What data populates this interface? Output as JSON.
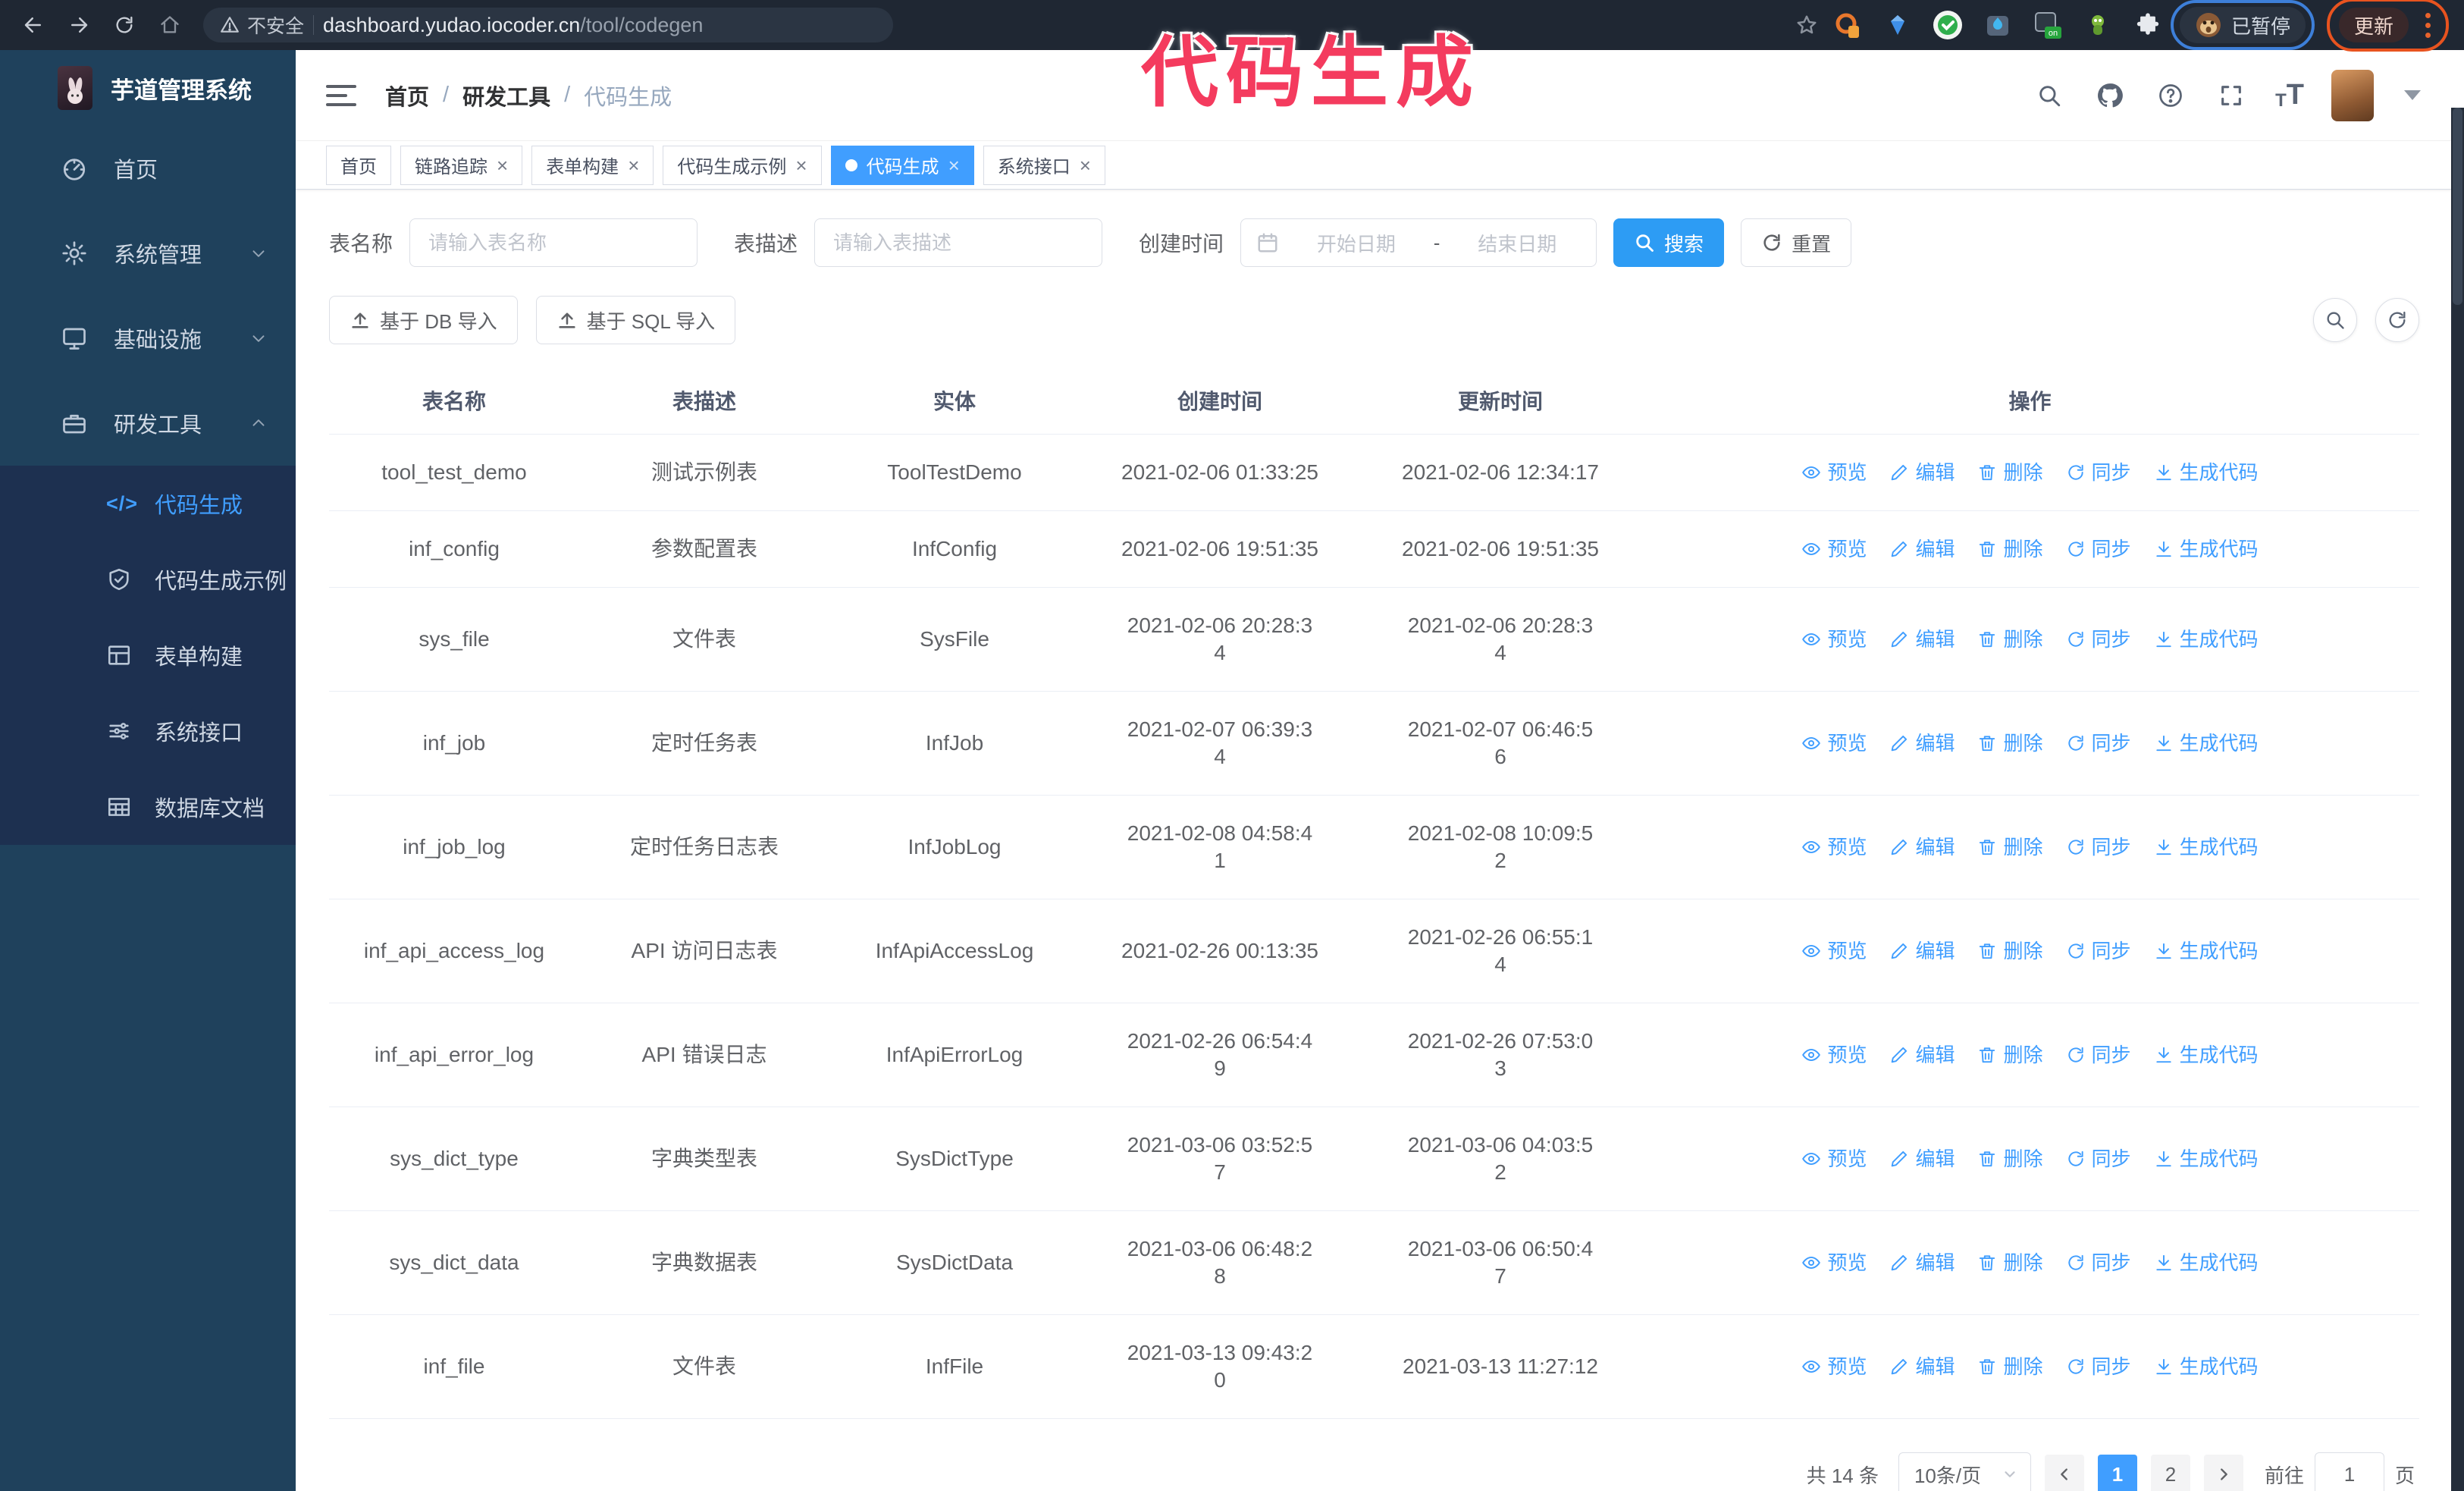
{
  "browser": {
    "security_label": "不安全",
    "url_host": "dashboard.yudao.iocoder.cn",
    "url_path": "/tool/codegen",
    "paused_badge": "已暂停",
    "update_button": "更新"
  },
  "overlay": {
    "text": "代码生成"
  },
  "sidebar": {
    "logo_title": "芋道管理系统",
    "items": [
      {
        "key": "home",
        "label": "首页",
        "icon": "dashboard-icon",
        "arrow": ""
      },
      {
        "key": "system",
        "label": "系统管理",
        "icon": "gear-icon",
        "arrow": "down"
      },
      {
        "key": "infra",
        "label": "基础设施",
        "icon": "monitor-icon",
        "arrow": "down"
      },
      {
        "key": "devtool",
        "label": "研发工具",
        "icon": "toolbox-icon",
        "arrow": "up"
      }
    ],
    "submenu": [
      {
        "key": "codegen",
        "label": "代码生成",
        "icon": "code-icon",
        "active": true
      },
      {
        "key": "codegen-example",
        "label": "代码生成示例",
        "icon": "shield-check-icon",
        "active": false
      },
      {
        "key": "form-builder",
        "label": "表单构建",
        "icon": "form-icon",
        "active": false
      },
      {
        "key": "system-api",
        "label": "系统接口",
        "icon": "api-icon",
        "active": false
      },
      {
        "key": "db-doc",
        "label": "数据库文档",
        "icon": "db-icon",
        "active": false
      }
    ]
  },
  "navbar": {
    "breadcrumb": [
      "首页",
      "研发工具",
      "代码生成"
    ],
    "separator": "/"
  },
  "tags": [
    {
      "key": "home",
      "label": "首页",
      "closable": false,
      "active": false
    },
    {
      "key": "trace",
      "label": "链路追踪",
      "closable": true,
      "active": false
    },
    {
      "key": "form-builder",
      "label": "表单构建",
      "closable": true,
      "active": false
    },
    {
      "key": "codegen-example",
      "label": "代码生成示例",
      "closable": true,
      "active": false
    },
    {
      "key": "codegen",
      "label": "代码生成",
      "closable": true,
      "active": true
    },
    {
      "key": "system-api",
      "label": "系统接口",
      "closable": true,
      "active": false
    }
  ],
  "search_form": {
    "name_label": "表名称",
    "name_placeholder": "请输入表名称",
    "desc_label": "表描述",
    "desc_placeholder": "请输入表描述",
    "time_label": "创建时间",
    "start_placeholder": "开始日期",
    "range_separator": "-",
    "end_placeholder": "结束日期",
    "search_button": "搜索",
    "reset_button": "重置"
  },
  "toolbar": {
    "import_db": "基于 DB 导入",
    "import_sql": "基于 SQL 导入"
  },
  "table": {
    "columns": [
      "表名称",
      "表描述",
      "实体",
      "创建时间",
      "更新时间",
      "操作"
    ],
    "actions": [
      {
        "key": "preview",
        "label": "预览",
        "icon": "eye-icon"
      },
      {
        "key": "edit",
        "label": "编辑",
        "icon": "edit-icon"
      },
      {
        "key": "delete",
        "label": "删除",
        "icon": "delete-icon"
      },
      {
        "key": "sync",
        "label": "同步",
        "icon": "sync-icon"
      },
      {
        "key": "generate",
        "label": "生成代码",
        "icon": "download-icon"
      }
    ],
    "rows": [
      {
        "name": "tool_test_demo",
        "desc": "测试示例表",
        "entity": "ToolTestDemo",
        "created": "2021-02-06 01:33:25",
        "updated": "2021-02-06 12:34:17"
      },
      {
        "name": "inf_config",
        "desc": "参数配置表",
        "entity": "InfConfig",
        "created": "2021-02-06 19:51:35",
        "updated": "2021-02-06 19:51:35"
      },
      {
        "name": "sys_file",
        "desc": "文件表",
        "entity": "SysFile",
        "created": "2021-02-06 20:28:3\n4",
        "updated": "2021-02-06 20:28:3\n4"
      },
      {
        "name": "inf_job",
        "desc": "定时任务表",
        "entity": "InfJob",
        "created": "2021-02-07 06:39:3\n4",
        "updated": "2021-02-07 06:46:5\n6"
      },
      {
        "name": "inf_job_log",
        "desc": "定时任务日志表",
        "entity": "InfJobLog",
        "created": "2021-02-08 04:58:4\n1",
        "updated": "2021-02-08 10:09:5\n2"
      },
      {
        "name": "inf_api_access_log",
        "desc": "API 访问日志表",
        "entity": "InfApiAccessLog",
        "created": "2021-02-26 00:13:35",
        "updated": "2021-02-26 06:55:1\n4"
      },
      {
        "name": "inf_api_error_log",
        "desc": "API 错误日志",
        "entity": "InfApiErrorLog",
        "created": "2021-02-26 06:54:4\n9",
        "updated": "2021-02-26 07:53:0\n3"
      },
      {
        "name": "sys_dict_type",
        "desc": "字典类型表",
        "entity": "SysDictType",
        "created": "2021-03-06 03:52:5\n7",
        "updated": "2021-03-06 04:03:5\n2"
      },
      {
        "name": "sys_dict_data",
        "desc": "字典数据表",
        "entity": "SysDictData",
        "created": "2021-03-06 06:48:2\n8",
        "updated": "2021-03-06 06:50:4\n7"
      },
      {
        "name": "inf_file",
        "desc": "文件表",
        "entity": "InfFile",
        "created": "2021-03-13 09:43:2\n0",
        "updated": "2021-03-13 11:27:12"
      }
    ]
  },
  "pagination": {
    "total": "共 14 条",
    "page_size": "10条/页",
    "pages": [
      "1",
      "2"
    ],
    "active_page": "1",
    "goto_label": "前往",
    "goto_value": "1",
    "page_label": "页"
  },
  "colors": {
    "primary": "#409eff",
    "sidebar": "#1f415c",
    "submenu": "#1d3050",
    "annotation": "#f43b5e"
  }
}
